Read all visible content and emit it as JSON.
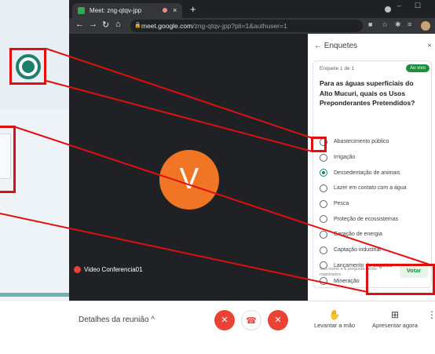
{
  "browser": {
    "tab_title": "Meet: zng-qtqv-jpp",
    "tab_close": "×",
    "new_tab": "+",
    "url_host": "meet.google.com",
    "url_path": "/zng-qtqv-jpp?pli=1&authuser=1"
  },
  "meet": {
    "participant_initial": "V",
    "participant_name": "Video Conferencia01",
    "meeting_details_label": "Detalhes da reunião",
    "raise_hand_label": "Levantar a mão",
    "present_label": "Apresentar agora"
  },
  "polls": {
    "panel_title": "Enquetes",
    "poll_counter": "Enquete 1 de 1",
    "live_badge": "Ao vivo",
    "question": "Para as águas superficiais do Alto Mucuri, quais os Usos Preponderantes Pretendidos?",
    "options": [
      {
        "label": "Abastecimento público",
        "selected": false
      },
      {
        "label": "Irrigação",
        "selected": false
      },
      {
        "label": "Dessedentação de animais",
        "selected": true
      },
      {
        "label": "Lazer em contato com a água",
        "selected": false
      },
      {
        "label": "Pesca",
        "selected": false
      },
      {
        "label": "Proteção de ecossistemas",
        "selected": false
      },
      {
        "label": "Geração de energia",
        "selected": false
      },
      {
        "label": "Captação industrial",
        "selected": false
      },
      {
        "label": "Lançamento de esgotos",
        "selected": false
      },
      {
        "label": "Mineração",
        "selected": false
      }
    ],
    "footnote": "Seu nome e a pergunta serão registrados",
    "vote_label": "Votar"
  },
  "colors": {
    "accent_green": "#1e7f6d",
    "annotation_red": "#e01010",
    "avatar_orange": "#f07625"
  }
}
